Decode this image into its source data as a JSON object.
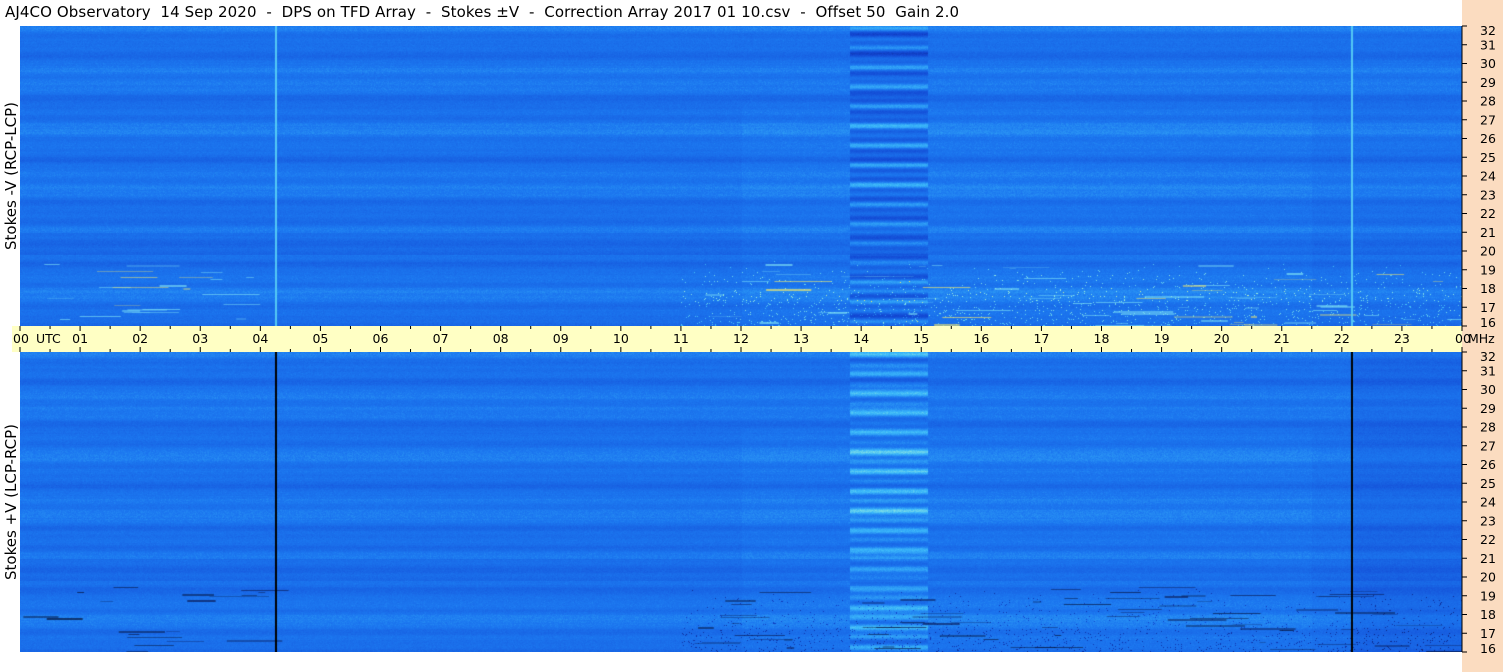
{
  "title": "AJ4CO Observatory  14 Sep 2020  -  DPS on TFD Array  -  Stokes ±V  -  Correction Array 2017 01 10.csv  -  Offset 50  Gain 2.0",
  "colors": {
    "background": "#ffffff",
    "time_axis_band": "#ffffc4",
    "freq_axis_band": "#fbdcc0",
    "spectrogram_base": "#1a64e6"
  },
  "chart_data": [
    {
      "type": "heatmap",
      "title": "",
      "ylabel": "Stokes -V (RCP-LCP)",
      "xlabel": "UTC",
      "xlim": [
        0,
        24
      ],
      "ylim": [
        16,
        32
      ],
      "y_unit": "MHz",
      "x_ticks": [
        "00",
        "01",
        "02",
        "03",
        "04",
        "05",
        "06",
        "07",
        "08",
        "09",
        "10",
        "11",
        "12",
        "13",
        "14",
        "15",
        "16",
        "17",
        "18",
        "19",
        "20",
        "21",
        "22",
        "23",
        "00"
      ],
      "y_ticks": [
        "16",
        "17",
        "18",
        "19",
        "20",
        "21",
        "22",
        "23",
        "24",
        "25",
        "26",
        "27",
        "28",
        "29",
        "30",
        "31",
        "32"
      ],
      "features": {
        "polarity": "light",
        "vertical_lines_utc": [
          4.25,
          22.15
        ],
        "bright_interference_band_utc": [
          13.8,
          15.1
        ],
        "high_activity_utc": [
          11.0,
          24.0
        ],
        "low_freq_activity_mhz": [
          16.0,
          19.5
        ]
      }
    },
    {
      "type": "heatmap",
      "title": "",
      "ylabel": "Stokes +V (LCP-RCP)",
      "xlabel": "UTC",
      "xlim": [
        0,
        24
      ],
      "ylim": [
        16,
        32
      ],
      "y_unit": "MHz",
      "x_ticks": [
        "00",
        "01",
        "02",
        "03",
        "04",
        "05",
        "06",
        "07",
        "08",
        "09",
        "10",
        "11",
        "12",
        "13",
        "14",
        "15",
        "16",
        "17",
        "18",
        "19",
        "20",
        "21",
        "22",
        "23",
        "00"
      ],
      "y_ticks": [
        "16",
        "17",
        "18",
        "19",
        "20",
        "21",
        "22",
        "23",
        "24",
        "25",
        "26",
        "27",
        "28",
        "29",
        "30",
        "31",
        "32"
      ],
      "features": {
        "polarity": "dark",
        "vertical_lines_utc": [
          4.25,
          22.15
        ],
        "bright_interference_band_utc": [
          13.8,
          15.1
        ],
        "high_activity_utc": [
          11.0,
          24.0
        ],
        "low_freq_activity_mhz": [
          16.0,
          19.5
        ]
      }
    }
  ],
  "axis": {
    "utc_label": "UTC",
    "mhz_label": "MHz"
  }
}
